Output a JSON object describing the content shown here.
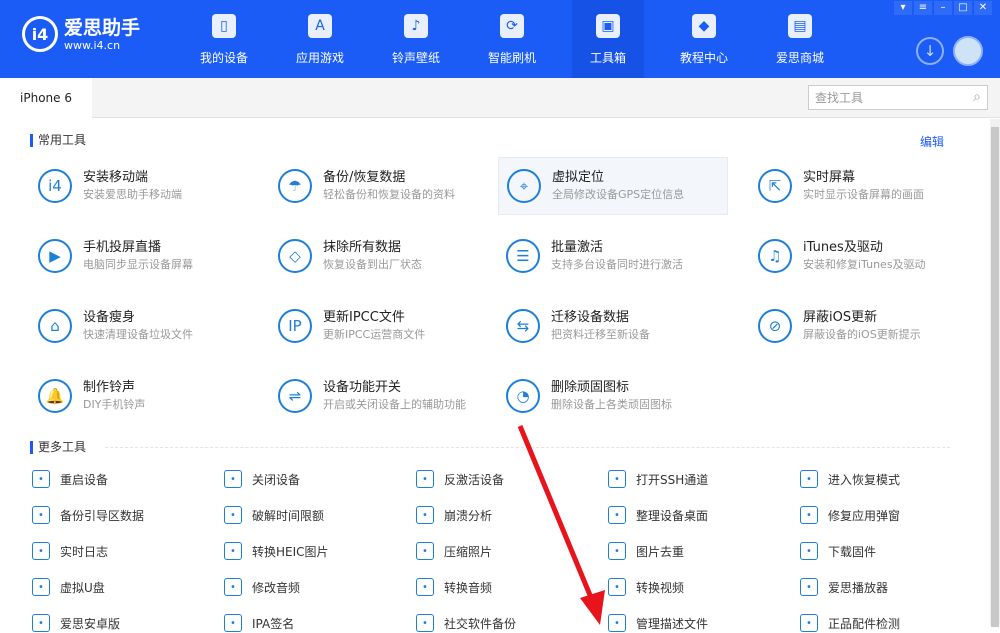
{
  "app": {
    "name": "爱思助手",
    "url": "www.i4.cn"
  },
  "nav": [
    {
      "label": "我的设备",
      "icon": "phone-icon"
    },
    {
      "label": "应用游戏",
      "icon": "appstore-icon"
    },
    {
      "label": "铃声壁纸",
      "icon": "music-icon"
    },
    {
      "label": "智能刷机",
      "icon": "refresh-icon"
    },
    {
      "label": "工具箱",
      "icon": "toolbox-icon",
      "active": true
    },
    {
      "label": "教程中心",
      "icon": "graduation-cap-icon"
    },
    {
      "label": "爱思商城",
      "icon": "store-icon"
    }
  ],
  "device_tab": "iPhone 6",
  "search": {
    "placeholder": "查找工具"
  },
  "common": {
    "title": "常用工具",
    "edit": "编辑",
    "items": [
      {
        "title": "安装移动端",
        "sub": "安装爱思助手移动端",
        "icon": "i4-icon"
      },
      {
        "title": "备份/恢复数据",
        "sub": "轻松备份和恢复设备的资料",
        "icon": "umbrella-icon"
      },
      {
        "title": "虚拟定位",
        "sub": "全局修改设备GPS定位信息",
        "icon": "location-pin-icon"
      },
      {
        "title": "实时屏幕",
        "sub": "实时显示设备屏幕的画面",
        "icon": "screen-mirror-icon"
      },
      {
        "title": "手机投屏直播",
        "sub": "电脑同步显示设备屏幕",
        "icon": "cast-icon"
      },
      {
        "title": "抹除所有数据",
        "sub": "恢复设备到出厂状态",
        "icon": "eraser-icon"
      },
      {
        "title": "批量激活",
        "sub": "支持多台设备同时进行激活",
        "icon": "batch-activate-icon"
      },
      {
        "title": "iTunes及驱动",
        "sub": "安装和修复iTunes及驱动",
        "icon": "itunes-icon"
      },
      {
        "title": "设备瘦身",
        "sub": "快速清理设备垃圾文件",
        "icon": "broom-icon"
      },
      {
        "title": "更新IPCC文件",
        "sub": "更新IPCC运营商文件",
        "icon": "ipcc-icon"
      },
      {
        "title": "迁移设备数据",
        "sub": "把资料迁移至新设备",
        "icon": "migrate-icon"
      },
      {
        "title": "屏蔽iOS更新",
        "sub": "屏蔽设备的iOS更新提示",
        "icon": "block-update-icon"
      },
      {
        "title": "制作铃声",
        "sub": "DIY手机铃声",
        "icon": "bell-icon"
      },
      {
        "title": "设备功能开关",
        "sub": "开启或关闭设备上的辅助功能",
        "icon": "toggle-icon"
      },
      {
        "title": "删除顽固图标",
        "sub": "删除设备上各类顽固图标",
        "icon": "clock-icon"
      }
    ]
  },
  "more": {
    "title": "更多工具",
    "items": [
      "重启设备",
      "关闭设备",
      "反激活设备",
      "打开SSH通道",
      "进入恢复模式",
      "备份引导区数据",
      "破解时间限额",
      "崩溃分析",
      "整理设备桌面",
      "修复应用弹窗",
      "实时日志",
      "转换HEIC图片",
      "压缩照片",
      "图片去重",
      "下载固件",
      "虚拟U盘",
      "修改音频",
      "转换音频",
      "转换视频",
      "爱思播放器",
      "爱思安卓版",
      "IPA签名",
      "社交软件备份",
      "管理描述文件",
      "正品配件检测"
    ]
  },
  "colors": {
    "brand": "#1a5cf5",
    "icon": "#1e7fd9",
    "arrow": "#e8141b"
  }
}
